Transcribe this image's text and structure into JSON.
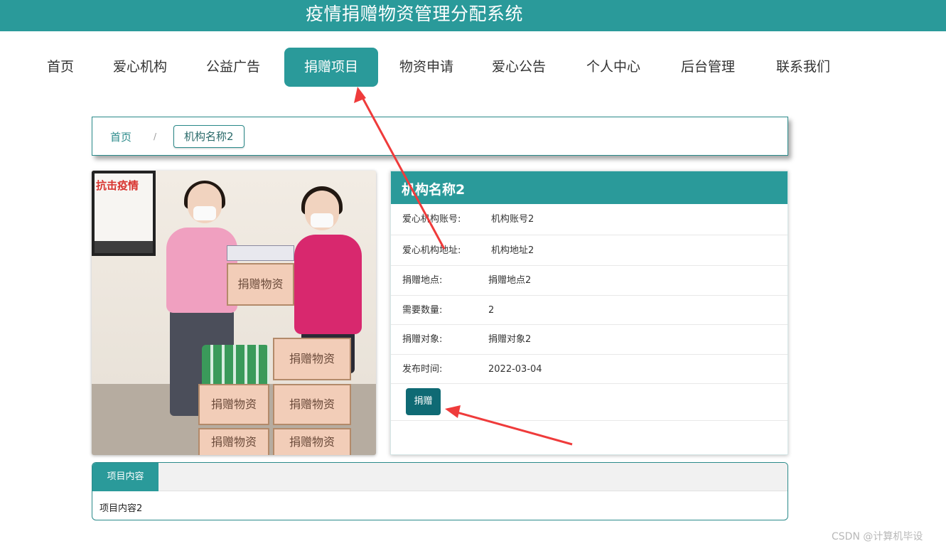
{
  "header": {
    "title": "疫情捐赠物资管理分配系统"
  },
  "nav": {
    "items": [
      {
        "label": "首页"
      },
      {
        "label": "爱心机构"
      },
      {
        "label": "公益广告"
      },
      {
        "label": "捐赠项目"
      },
      {
        "label": "物资申请"
      },
      {
        "label": "爱心公告"
      },
      {
        "label": "个人中心"
      },
      {
        "label": "后台管理"
      },
      {
        "label": "联系我们"
      }
    ],
    "active_index": 3,
    "accent_color": "#2a9a9a"
  },
  "breadcrumb": {
    "home": "首页",
    "separator": "/",
    "current": "机构名称2"
  },
  "photo": {
    "banner_text": "抗击疫情",
    "box_label": "捐赠物资"
  },
  "info": {
    "title": "机构名称2",
    "rows": [
      {
        "label": "爱心机构账号:",
        "value": "机构账号2"
      },
      {
        "label": "爱心机构地址:",
        "value": "机构地址2"
      },
      {
        "label": "捐赠地点:",
        "value": "捐赠地点2"
      },
      {
        "label": "需要数量:",
        "value": "2"
      },
      {
        "label": "捐赠对象:",
        "value": "捐赠对象2"
      },
      {
        "label": "发布时间:",
        "value": "2022-03-04"
      }
    ],
    "donate_button": "捐赠"
  },
  "content": {
    "tab_label": "项目内容",
    "text": "项目内容2"
  },
  "watermark": "CSDN @计算机毕设"
}
